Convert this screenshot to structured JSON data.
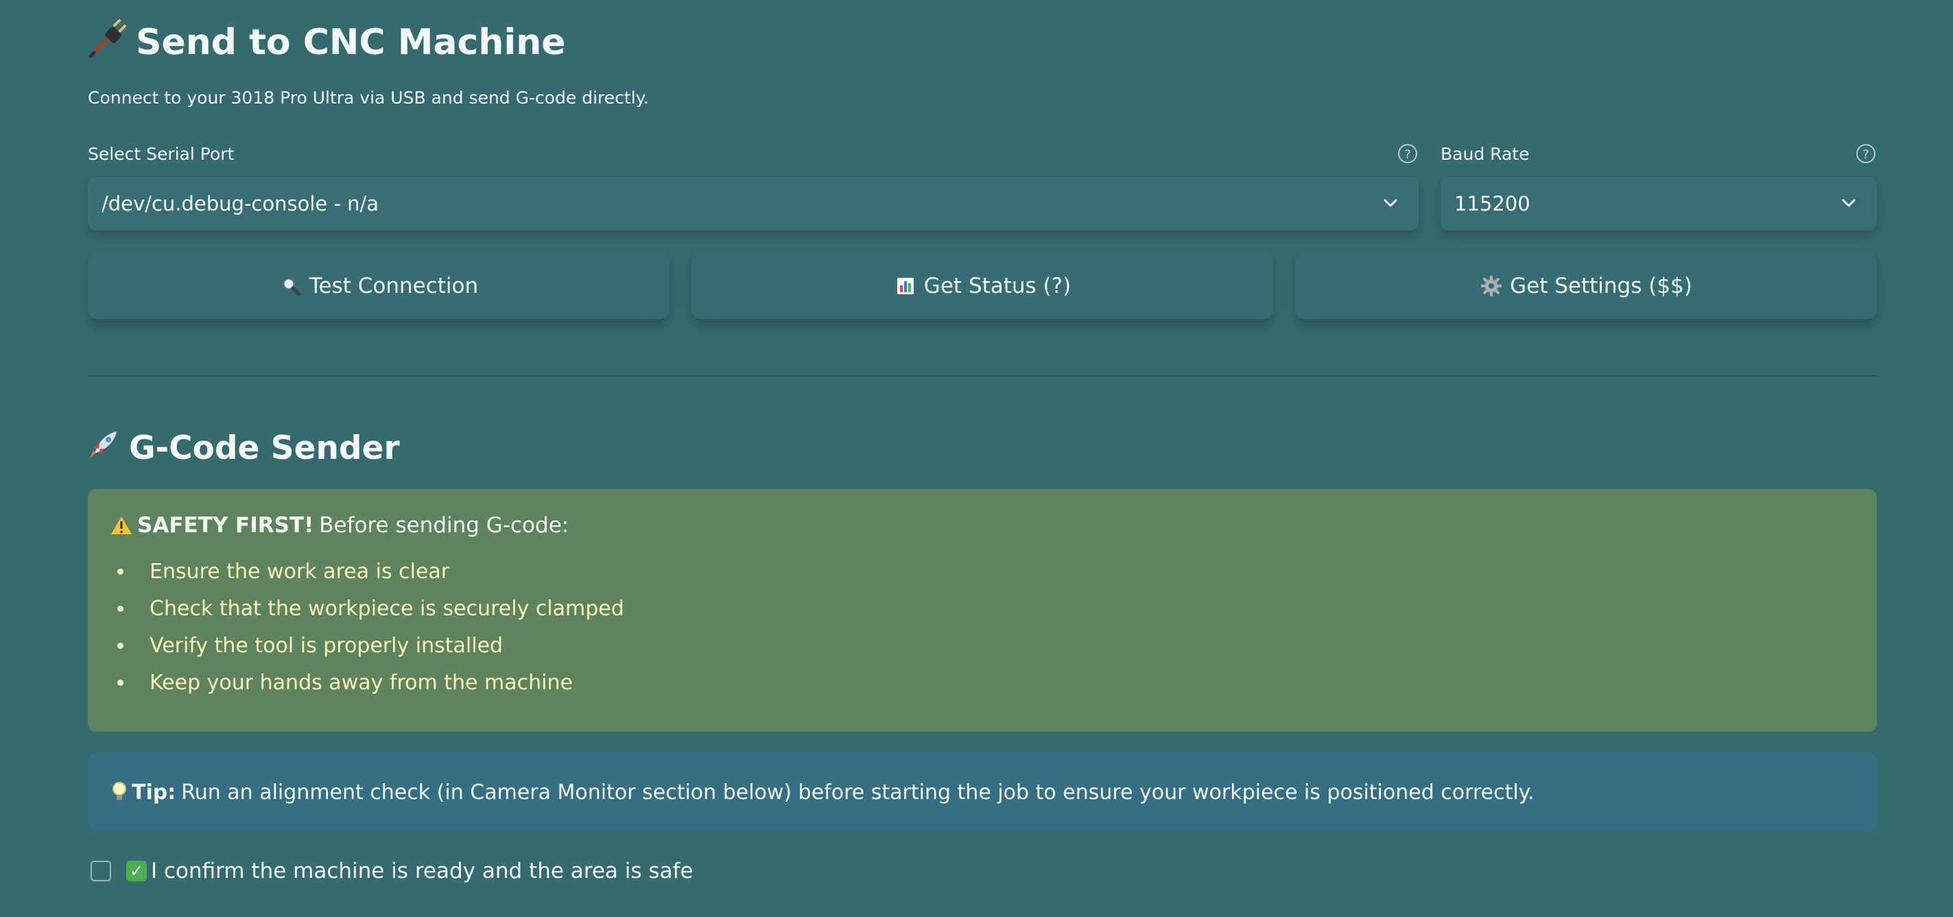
{
  "header": {
    "title": "Send to CNC Machine",
    "subtitle": "Connect to your 3018 Pro Ultra via USB and send G-code directly."
  },
  "serial_port": {
    "label": "Select Serial Port",
    "value": "/dev/cu.debug-console - n/a",
    "help_icon": "question-circle-icon",
    "chevron_icon": "chevron-down-icon"
  },
  "baud_rate": {
    "label": "Baud Rate",
    "value": "115200",
    "help_icon": "question-circle-icon",
    "chevron_icon": "chevron-down-icon"
  },
  "actions": {
    "test_connection": "Test Connection",
    "get_status": "Get Status (?)",
    "get_settings": "Get Settings ($$)"
  },
  "sender": {
    "title": "G-Code Sender"
  },
  "safety": {
    "title": "SAFETY FIRST!",
    "intro": "Before sending G-code:",
    "items": [
      "Ensure the work area is clear",
      "Check that the workpiece is securely clamped",
      "Verify the tool is properly installed",
      "Keep your hands away from the machine"
    ]
  },
  "tip": {
    "label": "Tip:",
    "text": "Run an alignment check (in Camera Monitor section below) before starting the job to ensure your workpiece is positioned correctly."
  },
  "confirmation": {
    "text": "I confirm the machine is ready and the area is safe",
    "checked": false
  },
  "colors": {
    "background": "#356b6f",
    "warning": "#5e845f",
    "tip": "#366f84",
    "warning_list_text": "#f7f2b6"
  }
}
